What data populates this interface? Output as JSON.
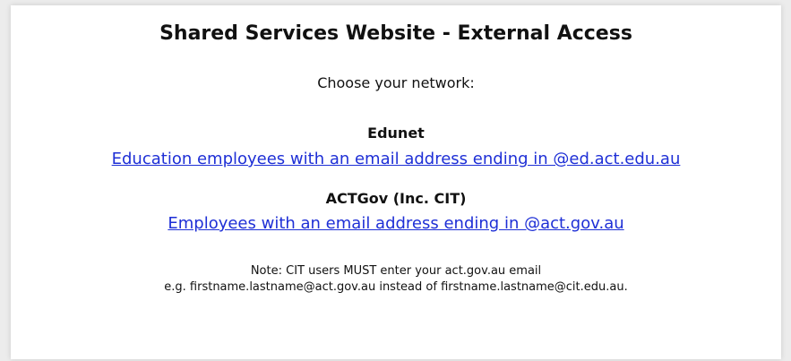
{
  "header": {
    "title": "Shared Services Website - External Access",
    "subtitle": "Choose your network:"
  },
  "networks": [
    {
      "name": "Edunet",
      "link_text": "Education employees with an email address ending in @ed.act.edu.au"
    },
    {
      "name": "ACTGov (Inc. CIT)",
      "link_text": "Employees with an email address ending in @act.gov.au"
    }
  ],
  "note": {
    "line1": "Note: CIT users MUST enter your act.gov.au email",
    "line2": "e.g. firstname.lastname@act.gov.au instead of firstname.lastname@cit.edu.au."
  },
  "colors": {
    "link": "#1e2fd6",
    "background": "#ffffff",
    "outer": "#ececec"
  }
}
